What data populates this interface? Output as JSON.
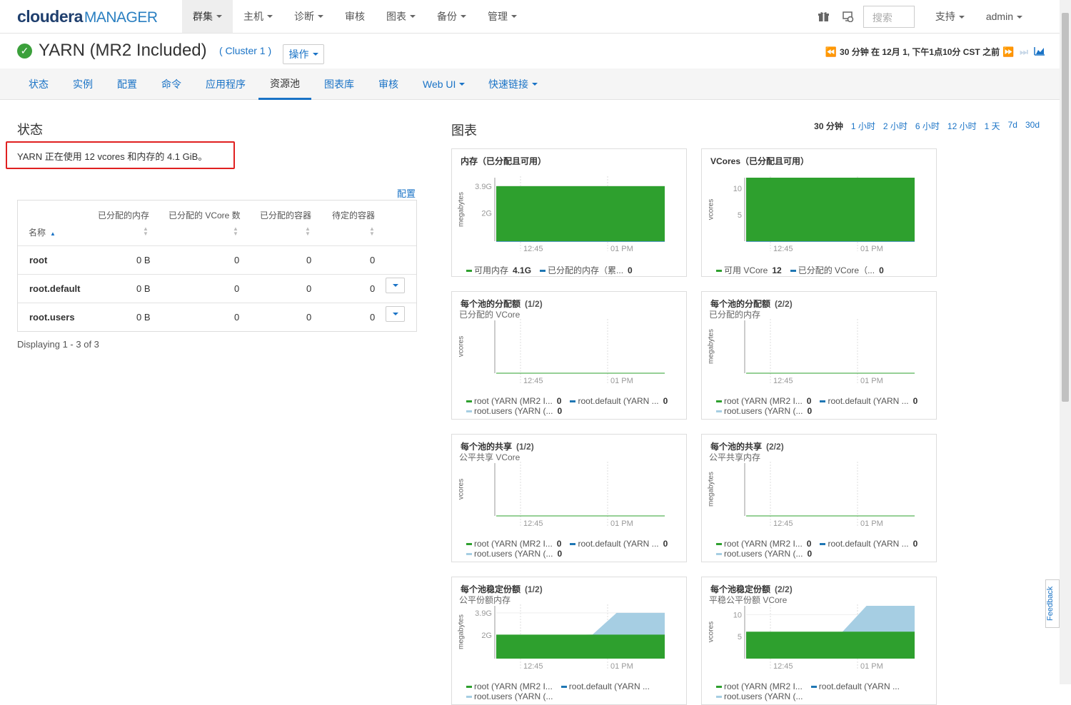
{
  "app": {
    "logo_main": "cloudera",
    "logo_sub": "MANAGER"
  },
  "nav": {
    "items": [
      {
        "label": "群集",
        "active": true,
        "dropdown": true
      },
      {
        "label": "主机",
        "dropdown": true
      },
      {
        "label": "诊断",
        "dropdown": true
      },
      {
        "label": "审核",
        "dropdown": false
      },
      {
        "label": "图表",
        "dropdown": true
      },
      {
        "label": "备份",
        "dropdown": true
      },
      {
        "label": "管理",
        "dropdown": true
      }
    ],
    "search_placeholder": "搜索",
    "support": "支持",
    "user": "admin"
  },
  "service": {
    "name": "YARN (MR2 Included)",
    "cluster": "( Cluster 1 )",
    "actions": "操作",
    "time_status": "30 分钟 在 12月 1, 下午1点10分 CST 之前"
  },
  "subnav": {
    "items": [
      "状态",
      "实例",
      "配置",
      "命令",
      "应用程序",
      "资源池",
      "图表库",
      "审核",
      "Web UI",
      "快速链接"
    ],
    "active_index": 5
  },
  "status": {
    "heading": "状态",
    "message": "YARN 正在使用 12 vcores 和内存的 4.1 GiB。",
    "config_link": "配置",
    "table": {
      "headers": [
        "名称",
        "已分配的内存",
        "已分配的 VCore 数",
        "已分配的容器",
        "待定的容器"
      ],
      "rows": [
        {
          "name": "root",
          "mem": "0 B",
          "vcores": "0",
          "containers": "0",
          "pending": "0"
        },
        {
          "name": "root.default",
          "mem": "0 B",
          "vcores": "0",
          "containers": "0",
          "pending": "0"
        },
        {
          "name": "root.users",
          "mem": "0 B",
          "vcores": "0",
          "containers": "0",
          "pending": "0"
        }
      ]
    },
    "displaying": "Displaying 1 - 3 of 3"
  },
  "charts_section": {
    "heading": "图表",
    "ranges": [
      "30 分钟",
      "1 小时",
      "2 小时",
      "6 小时",
      "12 小时",
      "1 天",
      "7d",
      "30d"
    ],
    "selected_range": 0
  },
  "colors": {
    "green": "#2ea02e",
    "blue": "#1f77b4",
    "light_blue": "#a6cee3",
    "link": "#1a73c6",
    "alert_border": "#e02020"
  },
  "chart_data": [
    {
      "type": "area",
      "title": "内存（已分配且可用）",
      "page": "",
      "subtitle": "",
      "ylabel": "megabytes",
      "x_ticks": [
        "12:45",
        "01 PM"
      ],
      "y_ticks": [
        "2G",
        "3.9G"
      ],
      "ylim": [
        0,
        4.5
      ],
      "series": [
        {
          "name": "可用内存",
          "value_label": "4.1G",
          "color": "#2ea02e",
          "values": [
            3.9,
            3.9,
            3.9,
            3.9,
            3.9,
            3.9,
            3.9,
            3.9
          ]
        },
        {
          "name": "已分配的内存（累...",
          "value_label": "0",
          "color": "#1f77b4",
          "values": [
            0,
            0,
            0,
            0,
            0,
            0,
            0,
            0
          ]
        }
      ]
    },
    {
      "type": "area",
      "title": "VCores（已分配且可用）",
      "page": "",
      "subtitle": "",
      "ylabel": "vcores",
      "x_ticks": [
        "12:45",
        "01 PM"
      ],
      "y_ticks": [
        "5",
        "10"
      ],
      "ylim": [
        0,
        12
      ],
      "series": [
        {
          "name": "可用 VCore",
          "value_label": "12",
          "color": "#2ea02e",
          "values": [
            12,
            12,
            12,
            12,
            12,
            12,
            12,
            12
          ]
        },
        {
          "name": "已分配的 VCore（...",
          "value_label": "0",
          "color": "#1f77b4",
          "values": [
            0,
            0,
            0,
            0,
            0,
            0,
            0,
            0
          ]
        }
      ]
    },
    {
      "type": "line",
      "title": "每个池的分配额",
      "page": "(1/2)",
      "subtitle": "已分配的 VCore",
      "ylabel": "vcores",
      "x_ticks": [
        "12:45",
        "01 PM"
      ],
      "y_ticks": [],
      "ylim": [
        0,
        1
      ],
      "series": [
        {
          "name": "root (YARN (MR2 I...",
          "value_label": "0",
          "color": "#2ea02e",
          "values": [
            0,
            0,
            0,
            0,
            0,
            0,
            0,
            0
          ]
        },
        {
          "name": "root.default (YARN ...",
          "value_label": "0",
          "color": "#1f77b4",
          "values": [
            0,
            0,
            0,
            0,
            0,
            0,
            0,
            0
          ]
        },
        {
          "name": "root.users (YARN (...",
          "value_label": "0",
          "color": "#a6cee3",
          "values": [
            0,
            0,
            0,
            0,
            0,
            0,
            0,
            0
          ]
        }
      ]
    },
    {
      "type": "line",
      "title": "每个池的分配额",
      "page": "(2/2)",
      "subtitle": "已分配的内存",
      "ylabel": "megabytes",
      "x_ticks": [
        "12:45",
        "01 PM"
      ],
      "y_ticks": [],
      "ylim": [
        0,
        1
      ],
      "series": [
        {
          "name": "root (YARN (MR2 I...",
          "value_label": "0",
          "color": "#2ea02e",
          "values": [
            0,
            0,
            0,
            0,
            0,
            0,
            0,
            0
          ]
        },
        {
          "name": "root.default (YARN ...",
          "value_label": "0",
          "color": "#1f77b4",
          "values": [
            0,
            0,
            0,
            0,
            0,
            0,
            0,
            0
          ]
        },
        {
          "name": "root.users (YARN (...",
          "value_label": "0",
          "color": "#a6cee3",
          "values": [
            0,
            0,
            0,
            0,
            0,
            0,
            0,
            0
          ]
        }
      ]
    },
    {
      "type": "line",
      "title": "每个池的共享",
      "page": "(1/2)",
      "subtitle": "公平共享 VCore",
      "ylabel": "vcores",
      "x_ticks": [
        "12:45",
        "01 PM"
      ],
      "y_ticks": [],
      "ylim": [
        0,
        1
      ],
      "series": [
        {
          "name": "root (YARN (MR2 I...",
          "value_label": "0",
          "color": "#2ea02e",
          "values": [
            0,
            0,
            0,
            0,
            0,
            0,
            0,
            0
          ]
        },
        {
          "name": "root.default (YARN ...",
          "value_label": "0",
          "color": "#1f77b4",
          "values": [
            0,
            0,
            0,
            0,
            0,
            0,
            0,
            0
          ]
        },
        {
          "name": "root.users (YARN (...",
          "value_label": "0",
          "color": "#a6cee3",
          "values": [
            0,
            0,
            0,
            0,
            0,
            0,
            0,
            0
          ]
        }
      ]
    },
    {
      "type": "line",
      "title": "每个池的共享",
      "page": "(2/2)",
      "subtitle": "公平共享内存",
      "ylabel": "megabytes",
      "x_ticks": [
        "12:45",
        "01 PM"
      ],
      "y_ticks": [],
      "ylim": [
        0,
        1
      ],
      "series": [
        {
          "name": "root (YARN (MR2 I...",
          "value_label": "0",
          "color": "#2ea02e",
          "values": [
            0,
            0,
            0,
            0,
            0,
            0,
            0,
            0
          ]
        },
        {
          "name": "root.default (YARN ...",
          "value_label": "0",
          "color": "#1f77b4",
          "values": [
            0,
            0,
            0,
            0,
            0,
            0,
            0,
            0
          ]
        },
        {
          "name": "root.users (YARN (...",
          "value_label": "0",
          "color": "#a6cee3",
          "values": [
            0,
            0,
            0,
            0,
            0,
            0,
            0,
            0
          ]
        }
      ]
    },
    {
      "type": "area",
      "title": "每个池稳定份额",
      "page": "(1/2)",
      "subtitle": "公平份额内存",
      "ylabel": "megabytes",
      "x_ticks": [
        "12:45",
        "01 PM"
      ],
      "y_ticks": [
        "2G",
        "3.9G"
      ],
      "ylim": [
        0,
        4.5
      ],
      "series": [
        {
          "name": "root (YARN (MR2 I...",
          "color": "#2ea02e",
          "values": [
            2,
            2,
            2,
            2,
            2,
            2,
            2,
            2
          ]
        },
        {
          "name": "root.default (YARN ...",
          "color": "#1f77b4",
          "values": [
            2,
            2,
            2,
            2,
            2,
            2,
            2,
            2
          ]
        },
        {
          "name": "root.users (YARN (...",
          "color": "#a6cee3",
          "values": [
            2,
            2,
            2,
            2,
            2.05,
            3.9,
            3.9,
            3.9
          ]
        }
      ]
    },
    {
      "type": "area",
      "title": "每个池稳定份额",
      "page": "(2/2)",
      "subtitle": "平稳公平份额 VCore",
      "ylabel": "vcores",
      "x_ticks": [
        "12:45",
        "01 PM"
      ],
      "y_ticks": [
        "5",
        "10"
      ],
      "ylim": [
        0,
        12
      ],
      "series": [
        {
          "name": "root (YARN (MR2 I...",
          "color": "#2ea02e",
          "values": [
            6,
            6,
            6,
            6,
            6,
            6,
            6,
            6
          ]
        },
        {
          "name": "root.default (YARN ...",
          "color": "#1f77b4",
          "values": [
            6,
            6,
            6,
            6,
            6,
            6,
            6,
            6
          ]
        },
        {
          "name": "root.users (YARN (...",
          "color": "#a6cee3",
          "values": [
            6,
            6,
            6,
            6,
            6.1,
            12,
            12,
            12
          ]
        }
      ]
    }
  ],
  "feedback": "Feedback"
}
